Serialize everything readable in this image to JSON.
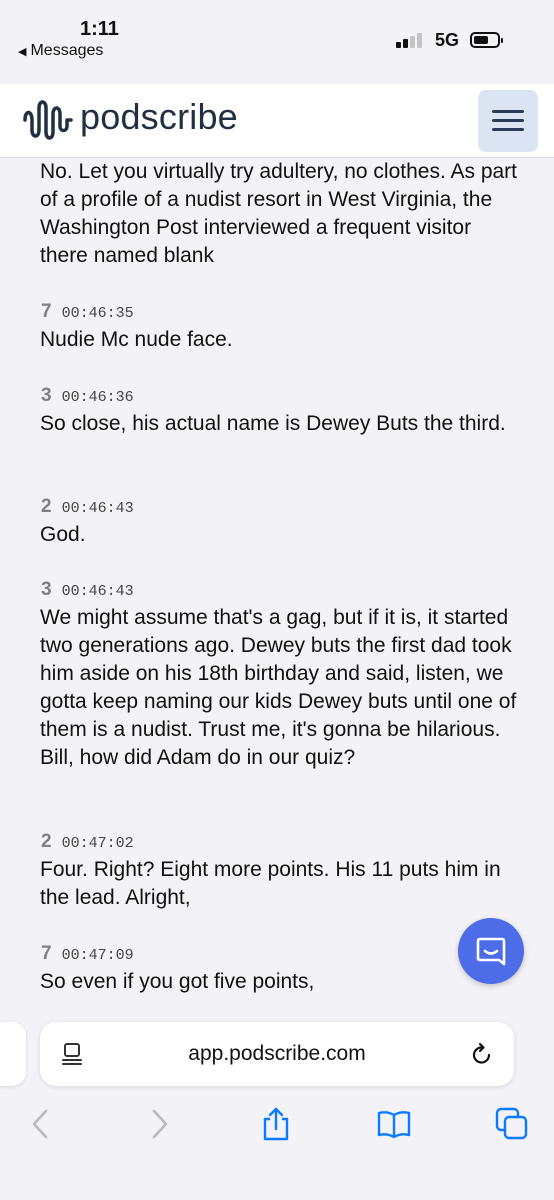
{
  "status_bar": {
    "time": "1:11",
    "back_label": "Messages",
    "network": "5G"
  },
  "header": {
    "brand": "podscribe"
  },
  "transcript": {
    "entries": [
      {
        "speaker": "",
        "timestamp": "",
        "text": "No. Let you virtually try adultery, no clothes. As part of a profile of a nudist resort in West Virginia, the Washington Post interviewed a frequent visitor there named blank"
      },
      {
        "speaker": "7",
        "timestamp": "00:46:35",
        "text": "Nudie Mc nude face."
      },
      {
        "speaker": "3",
        "timestamp": "00:46:36",
        "text": "So close, his actual name is Dewey Buts the third."
      },
      {
        "speaker": "2",
        "timestamp": "00:46:43",
        "text": "God."
      },
      {
        "speaker": "3",
        "timestamp": "00:46:43",
        "text": "We might assume that's a gag, but if it is, it started two generations ago. Dewey buts the first dad took him aside on his 18th birthday and said, listen, we gotta keep naming our kids Dewey buts until one of them is a nudist. Trust me, it's gonna be hilarious. Bill, how did Adam do in our quiz?"
      },
      {
        "speaker": "2",
        "timestamp": "00:47:02",
        "text": "Four. Right? Eight more points. His 11 puts him in the lead. Alright,"
      },
      {
        "speaker": "7",
        "timestamp": "00:47:09",
        "text": "So even if you got five points,"
      }
    ]
  },
  "browser": {
    "url": "app.podscribe.com"
  },
  "colors": {
    "accent": "#4c6ce8",
    "brand_text": "#203040",
    "menu_bg": "#dbe4f3",
    "ios_blue": "#0a7aff"
  },
  "icons": {
    "logo": "podscribe-waveform-icon",
    "menu": "hamburger-menu-icon",
    "chat": "chat-bubble-icon",
    "reader": "reader-mode-icon",
    "reload": "reload-icon",
    "back": "chevron-left-icon",
    "forward": "chevron-right-icon",
    "share": "share-icon",
    "bookmarks": "book-icon",
    "tabs": "tabs-icon"
  }
}
